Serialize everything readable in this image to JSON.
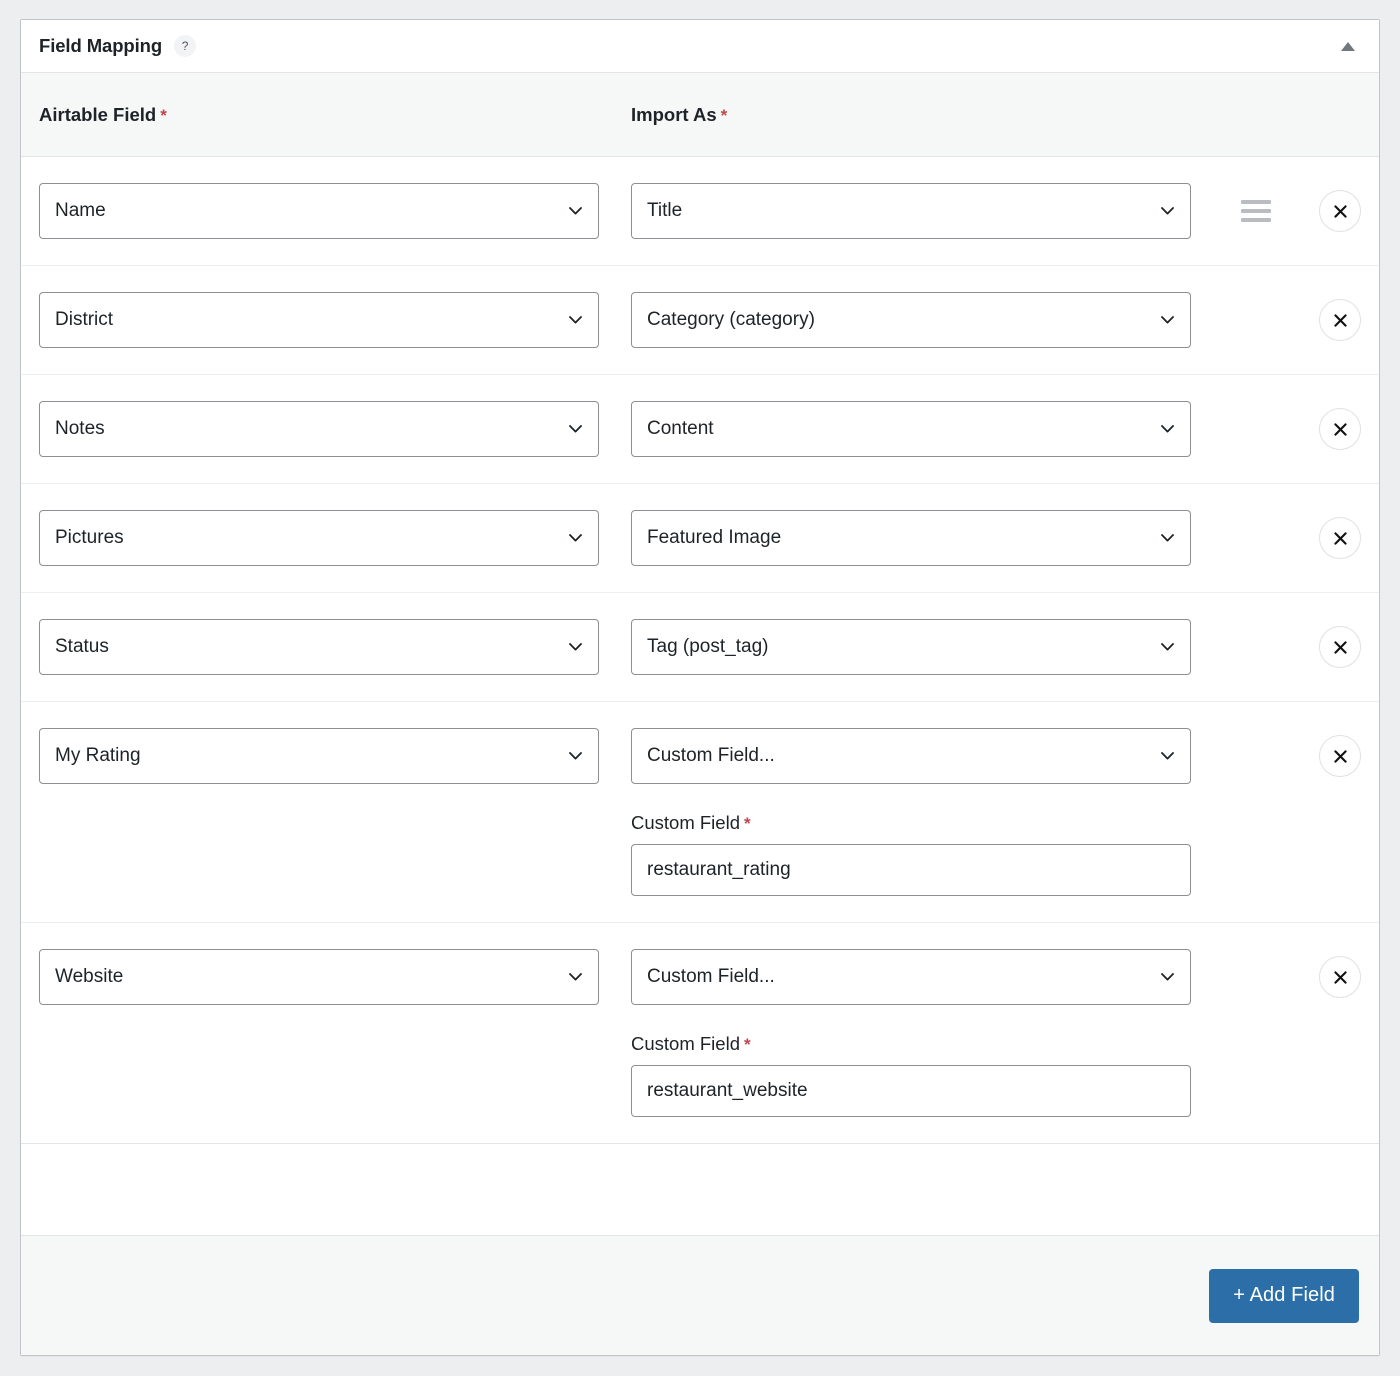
{
  "panel": {
    "title": "Field Mapping",
    "help_icon_label": "?",
    "collapse_icon": "triangle-up"
  },
  "columns": {
    "airtable_field": "Airtable Field",
    "import_as": "Import As",
    "required_marker": "*"
  },
  "rows": [
    {
      "airtable_field": "Name",
      "import_as": "Title",
      "has_drag_handle": true,
      "custom_field": null,
      "remove_label": "×"
    },
    {
      "airtable_field": "District",
      "import_as": "Category (category)",
      "has_drag_handle": false,
      "custom_field": null,
      "remove_label": "×"
    },
    {
      "airtable_field": "Notes",
      "import_as": "Content",
      "has_drag_handle": false,
      "custom_field": null,
      "remove_label": "×"
    },
    {
      "airtable_field": "Pictures",
      "import_as": "Featured Image",
      "has_drag_handle": false,
      "custom_field": null,
      "remove_label": "×"
    },
    {
      "airtable_field": "Status",
      "import_as": "Tag (post_tag)",
      "has_drag_handle": false,
      "custom_field": null,
      "remove_label": "×"
    },
    {
      "airtable_field": "My Rating",
      "import_as": "Custom Field...",
      "has_drag_handle": false,
      "custom_field": {
        "label": "Custom Field",
        "required_marker": "*",
        "value": "restaurant_rating"
      },
      "remove_label": "×"
    },
    {
      "airtable_field": "Website",
      "import_as": "Custom Field...",
      "has_drag_handle": false,
      "custom_field": {
        "label": "Custom Field",
        "required_marker": "*",
        "value": "restaurant_website"
      },
      "remove_label": "×"
    }
  ],
  "footer": {
    "add_field_label": "+ Add Field"
  },
  "colors": {
    "accent_button": "#2c6fa8",
    "required_asterisk": "#c0464c",
    "panel_border": "#c3c4c7",
    "header_strip": "#f6f7f7",
    "page_background": "#eceef0",
    "input_border": "#8c8f94"
  }
}
